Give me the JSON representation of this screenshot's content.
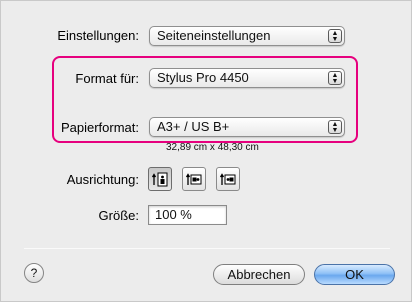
{
  "settings": {
    "label": "Einstellungen:",
    "value": "Seiteneinstellungen"
  },
  "format_for": {
    "label": "Format für:",
    "value": "Stylus Pro 4450"
  },
  "paper_size": {
    "label": "Papierformat:",
    "value": "A3+ / US B+",
    "dimensions": "32,89 cm x 48,30 cm"
  },
  "orientation": {
    "label": "Ausrichtung:",
    "options": [
      "portrait-icon",
      "landscape-icon",
      "reverse-landscape-icon"
    ],
    "selected": "portrait"
  },
  "scale": {
    "label": "Größe:",
    "value": "100 %"
  },
  "help_label": "?",
  "buttons": {
    "cancel": "Abbrechen",
    "ok": "OK"
  },
  "colors": {
    "highlight": "#e6007e",
    "default_button": "#6aa8ee"
  }
}
